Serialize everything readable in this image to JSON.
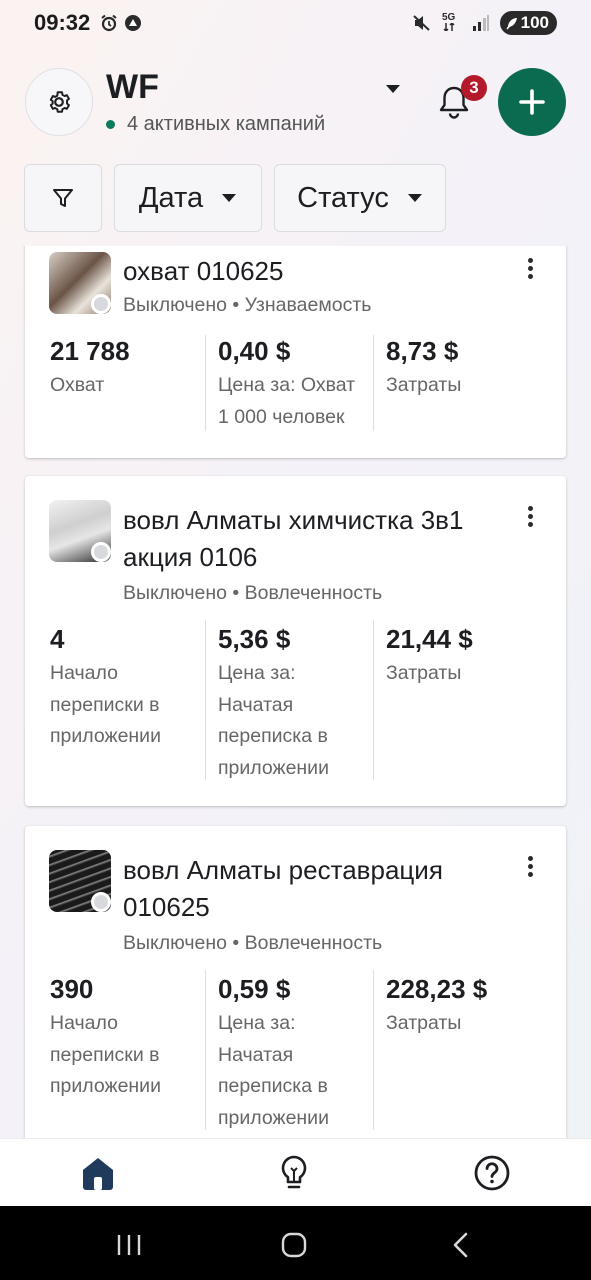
{
  "status_bar": {
    "time": "09:32",
    "network": "5G",
    "battery": "100",
    "icons": [
      "alarm-icon",
      "app-notification-icon",
      "mute-icon",
      "signal-icon",
      "battery-icon"
    ]
  },
  "header": {
    "account_name": "WF",
    "active_campaigns": "4 активных кампаний",
    "notification_count": "3",
    "status_dot_color": "#0a7a5b",
    "add_button_color": "#0b6b50",
    "badge_color": "#b3192a"
  },
  "filters": {
    "date_label": "Дата",
    "status_label": "Статус"
  },
  "campaigns": [
    {
      "title": "охват 010625",
      "status": "Выключено",
      "objective": "Узнаваемость",
      "stats": [
        {
          "value": "21 788",
          "label": "Охват"
        },
        {
          "value": "0,40 $",
          "label": "Цена за: Охват 1 000 человек"
        },
        {
          "value": "8,73 $",
          "label": "Затраты"
        }
      ]
    },
    {
      "title": "вовл Алматы химчистка 3в1 акция 0106",
      "status": "Выключено",
      "objective": "Вовлеченность",
      "stats": [
        {
          "value": "4",
          "label": "Начало переписки в приложении"
        },
        {
          "value": "5,36 $",
          "label": "Цена за: Начатая переписка в приложении"
        },
        {
          "value": "21,44 $",
          "label": "Затраты"
        }
      ]
    },
    {
      "title": "вовл Алматы реставрация 010625",
      "status": "Выключено",
      "objective": "Вовлеченность",
      "stats": [
        {
          "value": "390",
          "label": "Начало переписки в приложении"
        },
        {
          "value": "0,59 $",
          "label": "Цена за: Начатая переписка в приложении"
        },
        {
          "value": "228,23 $",
          "label": "Затраты"
        }
      ]
    }
  ],
  "separator": "•",
  "bottom_nav": [
    "home-icon",
    "lightbulb-icon",
    "help-icon"
  ],
  "system_nav": [
    "recents-icon",
    "home-circle-icon",
    "back-icon"
  ]
}
